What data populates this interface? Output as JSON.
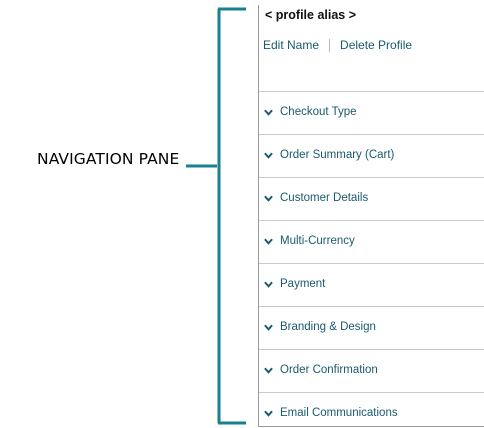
{
  "callout": {
    "label": "NAVIGATION PANE"
  },
  "colors": {
    "bracket": "#1a7f8e",
    "link": "#1a5a6e"
  },
  "panel": {
    "profile_alias": "< profile alias >",
    "actions": {
      "edit_name": "Edit Name",
      "delete_profile": "Delete Profile"
    },
    "sections": [
      {
        "label": "Checkout Type",
        "icon": "chevron-down-icon"
      },
      {
        "label": "Order Summary (Cart)",
        "icon": "chevron-down-icon"
      },
      {
        "label": "Customer Details",
        "icon": "chevron-down-icon"
      },
      {
        "label": "Multi-Currency",
        "icon": "chevron-down-icon"
      },
      {
        "label": "Payment",
        "icon": "chevron-down-icon"
      },
      {
        "label": "Branding & Design",
        "icon": "chevron-down-icon"
      },
      {
        "label": "Order Confirmation",
        "icon": "chevron-down-icon"
      },
      {
        "label": "Email Communications",
        "icon": "chevron-down-icon"
      }
    ]
  }
}
